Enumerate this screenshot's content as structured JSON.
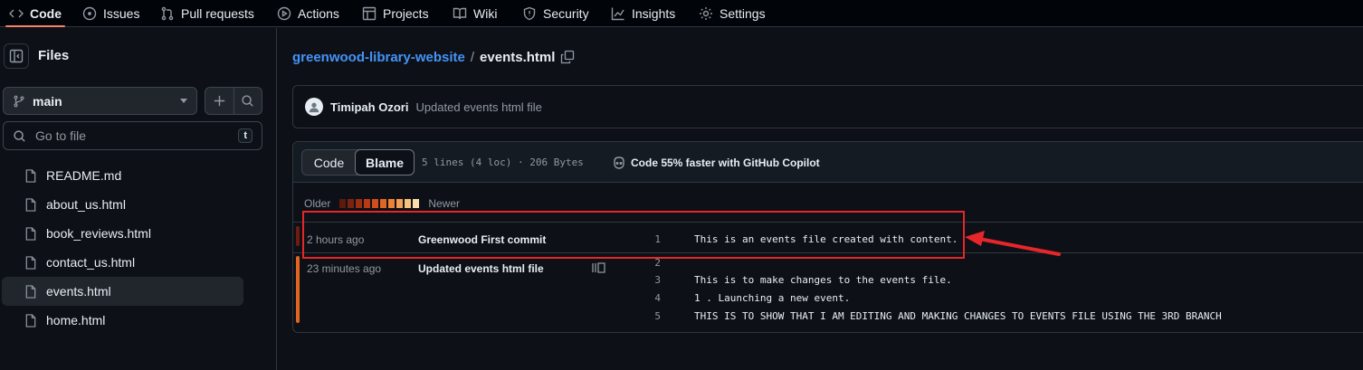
{
  "nav": {
    "tabs": [
      {
        "label": "Code",
        "icon": "code-icon",
        "active": true
      },
      {
        "label": "Issues",
        "icon": "issue-icon"
      },
      {
        "label": "Pull requests",
        "icon": "pull-request-icon"
      },
      {
        "label": "Actions",
        "icon": "play-icon"
      },
      {
        "label": "Projects",
        "icon": "table-icon"
      },
      {
        "label": "Wiki",
        "icon": "book-icon"
      },
      {
        "label": "Security",
        "icon": "shield-icon"
      },
      {
        "label": "Insights",
        "icon": "graph-icon"
      },
      {
        "label": "Settings",
        "icon": "gear-icon"
      }
    ]
  },
  "sidebar": {
    "title": "Files",
    "branch": "main",
    "search_placeholder": "Go to file",
    "search_shortcut": "t",
    "files": [
      {
        "name": "README.md"
      },
      {
        "name": "about_us.html"
      },
      {
        "name": "book_reviews.html"
      },
      {
        "name": "contact_us.html"
      },
      {
        "name": "events.html",
        "selected": true
      },
      {
        "name": "home.html"
      }
    ]
  },
  "breadcrumb": {
    "repo": "greenwood-library-website",
    "separator": "/",
    "file": "events.html"
  },
  "latest_commit": {
    "author": "Timipah Ozori",
    "message": "Updated events html file"
  },
  "blame": {
    "toggle_code": "Code",
    "toggle_blame": "Blame",
    "meta": "5 lines (4 loc) · 206 Bytes",
    "copilot": "Code 55% faster with GitHub Copilot",
    "legend_older": "Older",
    "legend_newer": "Newer",
    "legend_colors": [
      "#5c1a0b",
      "#7a230f",
      "#9a2d12",
      "#b73a14",
      "#cf4e1a",
      "#e0651f",
      "#ec8236",
      "#f3a055",
      "#f7c07c",
      "#fbdcab"
    ],
    "hunks": [
      {
        "time": "2 hours ago",
        "message": "Greenwood First commit",
        "bar_color": "#6e1c10",
        "lines": [
          {
            "no": "1",
            "text": "This is an events file created with content."
          }
        ]
      },
      {
        "time": "23 minutes ago",
        "message": "Updated events html file",
        "bar_color": "#e0651f",
        "lines": [
          {
            "no": "2",
            "text": ""
          },
          {
            "no": "3",
            "text": "This is to make changes to the events file."
          },
          {
            "no": "4",
            "text": "1 . Launching a new event."
          },
          {
            "no": "5",
            "text": "THIS IS TO SHOW THAT I AM EDITING AND MAKING CHANGES TO EVENTS FILE USING THE 3RD BRANCH"
          }
        ]
      }
    ]
  },
  "annotation_color": "#e5262a"
}
